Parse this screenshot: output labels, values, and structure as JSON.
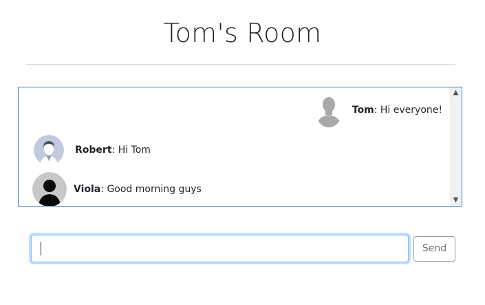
{
  "room": {
    "title": "Tom's Room"
  },
  "messages": [
    {
      "author": "Tom",
      "separator": ": ",
      "text": "Hi everyone!",
      "avatar_icon": "user-silhouette-gray-icon",
      "align": "right"
    },
    {
      "author": "Robert",
      "separator": ": ",
      "text": "Hi Tom",
      "avatar_icon": "user-avatar-man-icon",
      "align": "left"
    },
    {
      "author": "Viola",
      "separator": ": ",
      "text": "Good morning guys",
      "avatar_icon": "user-avatar-black-icon",
      "align": "left"
    }
  ],
  "composer": {
    "input_value": "",
    "placeholder": "",
    "send_label": "Send"
  },
  "colors": {
    "chat_border": "#3f7fc8",
    "input_focus": "#80bdff",
    "send_text": "#6c757d"
  }
}
